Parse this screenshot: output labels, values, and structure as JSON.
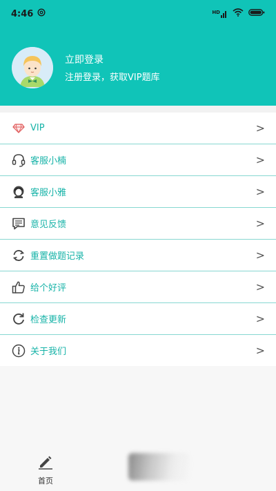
{
  "status_bar": {
    "time": "4:46",
    "network_label": "HD"
  },
  "profile": {
    "title": "立即登录",
    "subtitle": "注册登录，获取VIP题库"
  },
  "menu": {
    "items": [
      {
        "label": "VIP",
        "icon": "diamond-icon"
      },
      {
        "label": "客服小楠",
        "icon": "headset-icon"
      },
      {
        "label": "客服小雅",
        "icon": "agent-icon"
      },
      {
        "label": "意见反馈",
        "icon": "feedback-icon"
      },
      {
        "label": "重置做题记录",
        "icon": "refresh-icon"
      },
      {
        "label": "给个好评",
        "icon": "thumbs-up-icon"
      },
      {
        "label": "检查更新",
        "icon": "update-icon"
      },
      {
        "label": "关于我们",
        "icon": "info-icon"
      }
    ],
    "chevron": ">"
  },
  "tabbar": {
    "home_label": "首页"
  },
  "colors": {
    "header_bg": "#10c4b8",
    "accent_text": "#17b3a8",
    "divider": "#86d7d1",
    "vip_icon": "#e05a5a"
  }
}
